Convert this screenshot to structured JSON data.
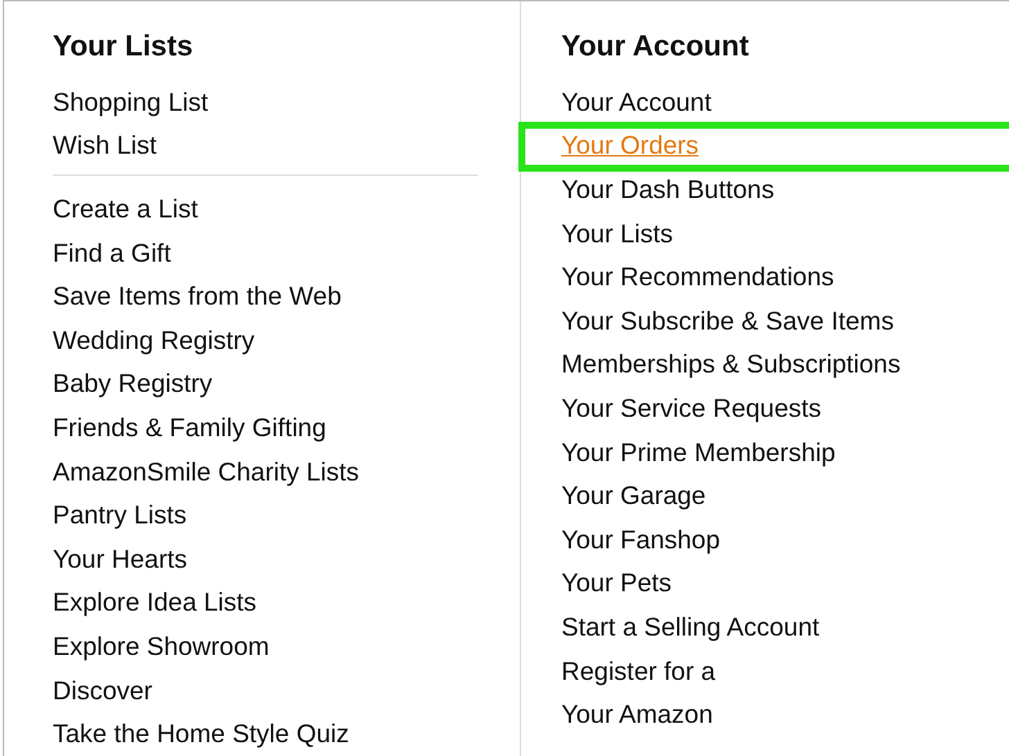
{
  "lists_column": {
    "heading": "Your Lists",
    "sections": [
      [
        "Shopping List",
        "Wish List"
      ],
      [
        "Create a List",
        "Find a Gift",
        "Save Items from the Web",
        "Wedding Registry",
        "Baby Registry",
        "Friends & Family Gifting",
        "AmazonSmile Charity Lists",
        "Pantry Lists",
        "Your Hearts",
        "Explore Idea Lists",
        "Explore Showroom",
        "Discover",
        "Take the Home Style Quiz"
      ]
    ]
  },
  "account_column": {
    "heading": "Your Account",
    "items": [
      {
        "label": "Your Account",
        "highlighted": false
      },
      {
        "label": "Your Orders",
        "highlighted": true
      },
      {
        "label": "Your Dash Buttons",
        "highlighted": false
      },
      {
        "label": "Your Lists",
        "highlighted": false
      },
      {
        "label": "Your Recommendations",
        "highlighted": false
      },
      {
        "label": "Your Subscribe & Save Items",
        "highlighted": false
      },
      {
        "label": "Memberships & Subscriptions",
        "highlighted": false
      },
      {
        "label": "Your Service Requests",
        "highlighted": false
      },
      {
        "label": "Your Prime Membership",
        "highlighted": false
      },
      {
        "label": "Your Garage",
        "highlighted": false
      },
      {
        "label": "Your Fanshop",
        "highlighted": false
      },
      {
        "label": "Your Pets",
        "highlighted": false
      },
      {
        "label": "Start a Selling Account",
        "highlighted": false
      },
      {
        "label": "Register for a",
        "highlighted": false
      },
      {
        "label": "Your Amazon",
        "highlighted": false
      }
    ]
  }
}
